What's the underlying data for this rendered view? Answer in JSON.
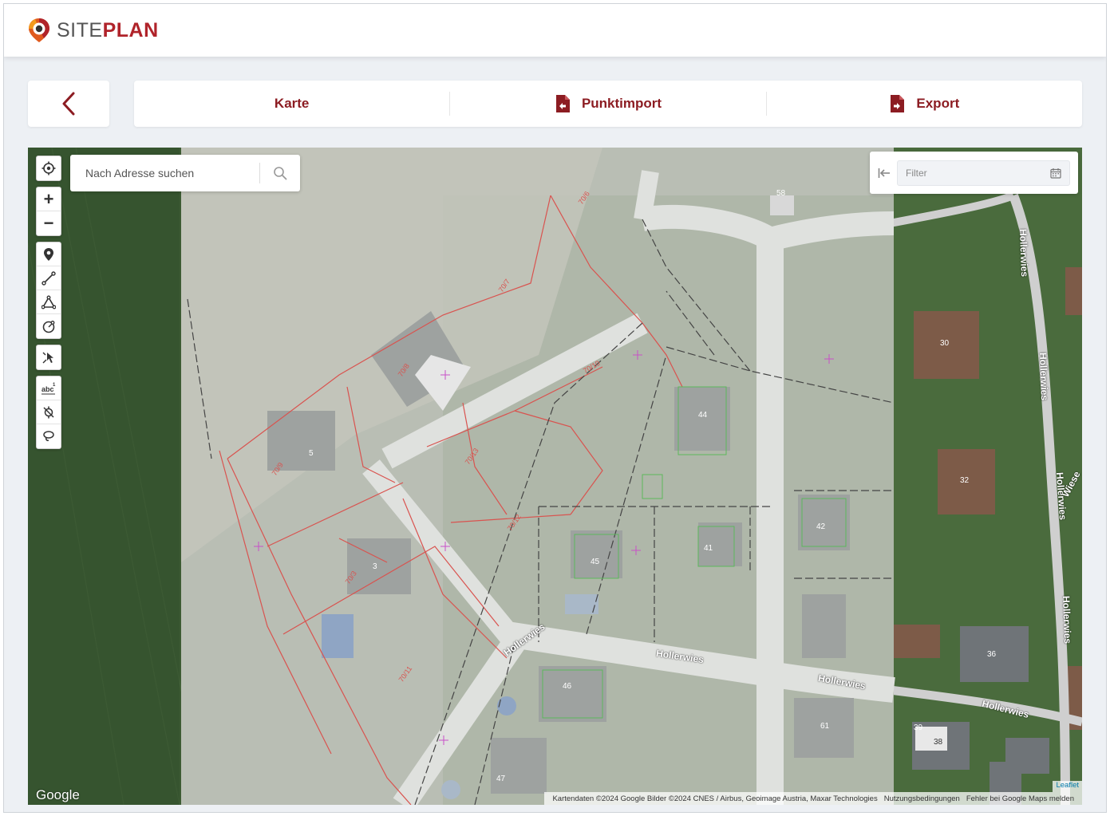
{
  "brand": {
    "name_light": "SITE",
    "name_bold": "PLAN",
    "accent": "#b0232a"
  },
  "header": {
    "back_icon": "chevron-left-icon"
  },
  "tabs": [
    {
      "label": "Karte",
      "icon": ""
    },
    {
      "label": "Punktimport",
      "icon": "file-import-icon"
    },
    {
      "label": "Export",
      "icon": "file-export-icon"
    }
  ],
  "map": {
    "search": {
      "placeholder": "Nach Adresse suchen"
    },
    "filter": {
      "placeholder": "Filter"
    },
    "toolbar": [
      [
        "locate-icon"
      ],
      [
        "zoom-in-icon",
        "zoom-out-icon"
      ],
      [
        "marker-icon",
        "polyline-icon",
        "polygon-icon",
        "circle-icon"
      ],
      [
        "pointer-tool-icon"
      ],
      [
        "label-icon",
        "disable-snap-icon",
        "lasso-icon"
      ]
    ],
    "zoom_in": "+",
    "zoom_out": "−",
    "street_labels": [
      "Hollerwies",
      "Hollerwies",
      "Hollerwies",
      "Hollerwies",
      "Hollerwies",
      "Hollerwies",
      "Hollerwies",
      "Hollerwies",
      "Wiese"
    ],
    "house_numbers": [
      "30",
      "32",
      "36",
      "38",
      "39",
      "42",
      "41",
      "44",
      "45",
      "46",
      "47",
      "61",
      "58",
      "3",
      "5"
    ],
    "parcel_labels": [
      "70/6",
      "70/7",
      "70/8",
      "70/9",
      "70/10",
      "70/11",
      "70/12",
      "70/13",
      "70/3"
    ],
    "google_logo": "Google",
    "leaflet_link": "Leaflet",
    "attribution": {
      "data": "Kartendaten ©2024 Google Bilder ©2024 CNES / Airbus, Geoimage Austria, Maxar Technologies",
      "terms": "Nutzungsbedingungen",
      "report": "Fehler bei Google Maps melden"
    }
  }
}
